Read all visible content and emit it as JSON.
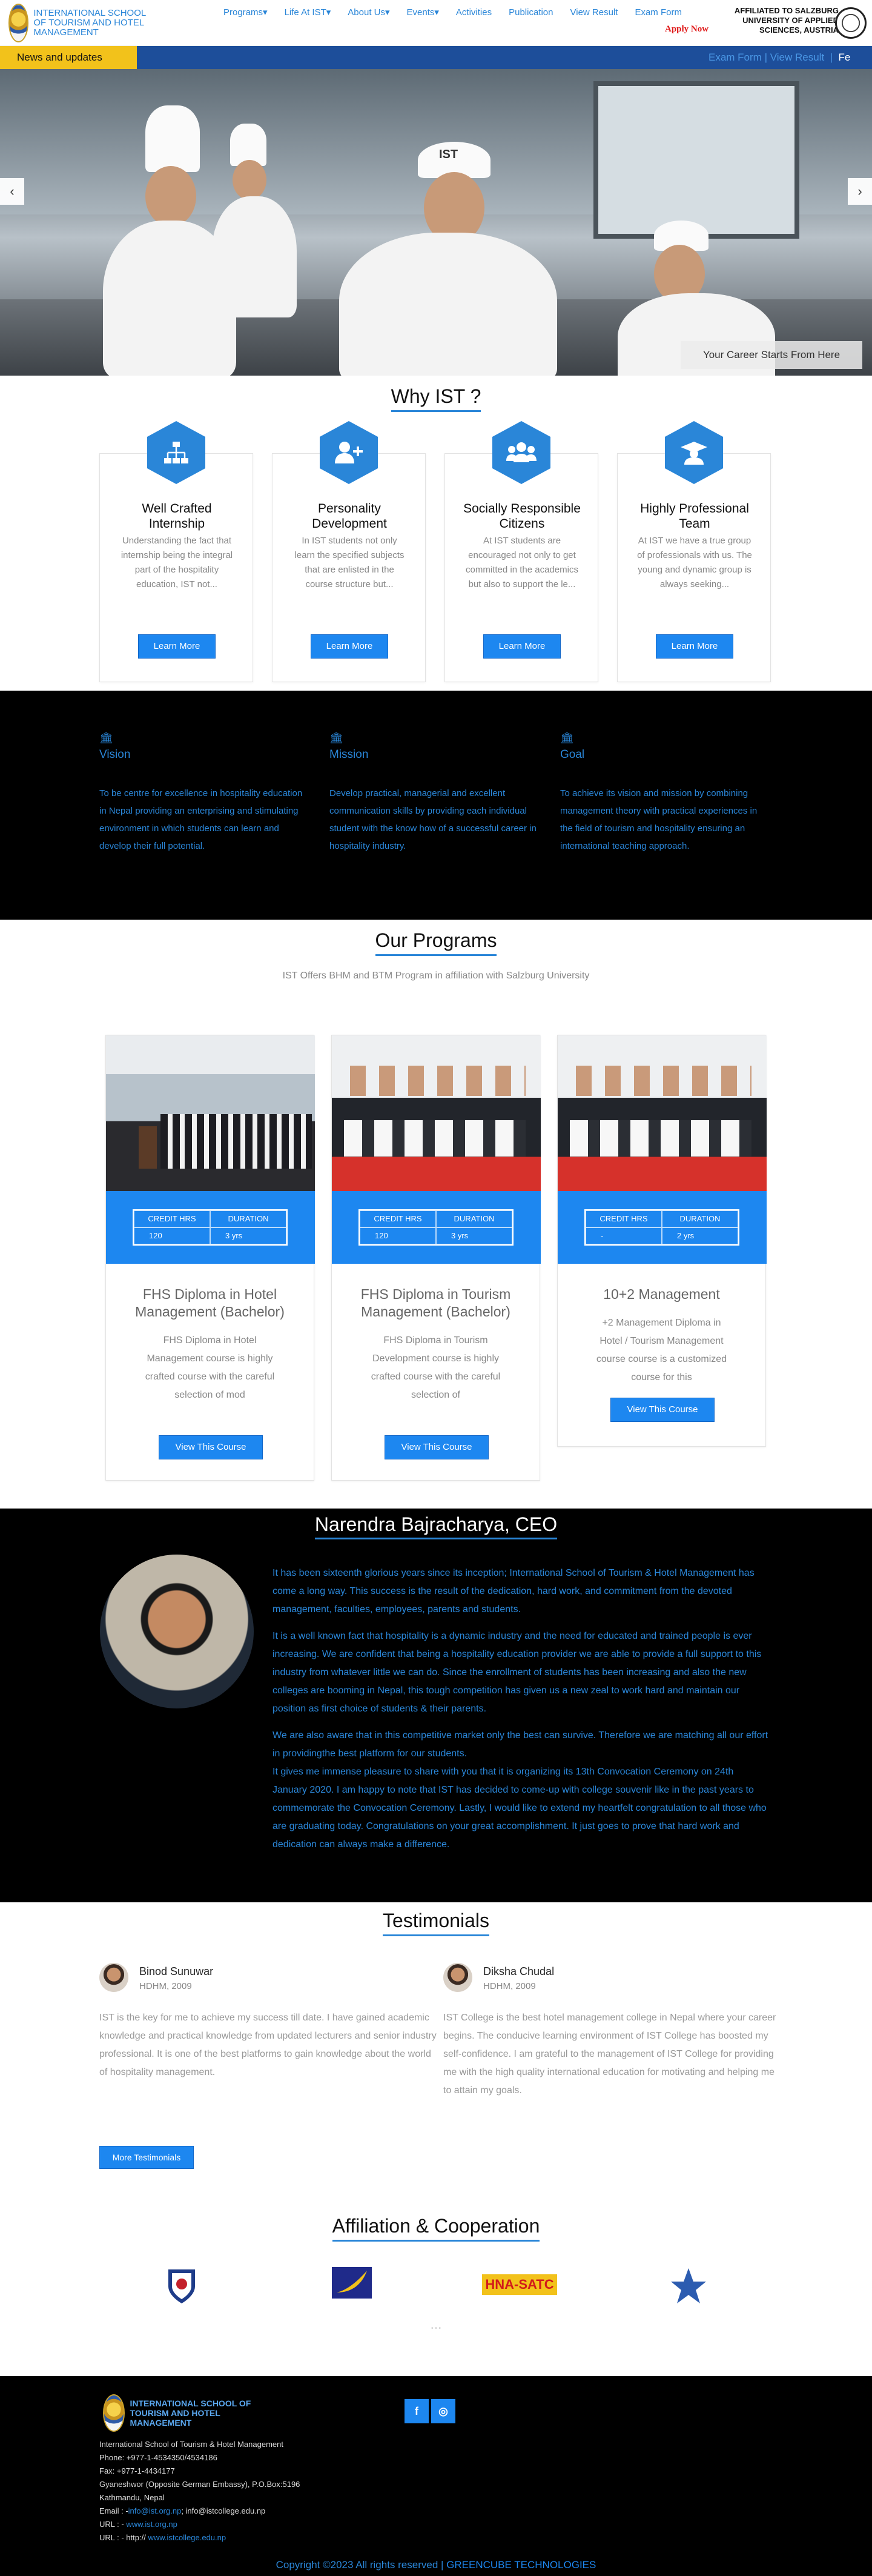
{
  "header": {
    "logo_text": "INTERNATIONAL SCHOOL OF TOURISM AND HOTEL MANAGEMENT",
    "nav": [
      {
        "label": "Programs",
        "caret": true
      },
      {
        "label": "Life At IST",
        "caret": true
      },
      {
        "label": "About Us",
        "caret": true
      },
      {
        "label": "Events",
        "caret": true
      },
      {
        "label": "Activities",
        "caret": false
      },
      {
        "label": "Publication",
        "caret": false
      },
      {
        "label": "View Result",
        "caret": false
      },
      {
        "label": "Exam Form",
        "caret": false
      }
    ],
    "apply_now": "Apply Now",
    "affiliated": "AFFILIATED TO SALZBURG UNIVERSITY OF APPLIED SCIENCES, AUSTRIA"
  },
  "ticker": {
    "label": "News and updates",
    "items": [
      "Exam Form",
      "View Result",
      "Fe"
    ]
  },
  "hero": {
    "caption": "Your Career Starts From Here",
    "cap_text": "IST"
  },
  "why": {
    "title": "Why IST ?",
    "cards": [
      {
        "title": "Well Crafted Internship",
        "icon": "sitemap-icon",
        "text": "Understanding the fact that internship being the integral part of the hospitality education, IST not...",
        "button": "Learn More"
      },
      {
        "title": "Personality Development",
        "icon": "user-plus-icon",
        "text": "In IST students not only learn the specified subjects that are enlisted in the course structure but...",
        "button": "Learn More"
      },
      {
        "title": "Socially Responsible Citizens",
        "icon": "users-icon",
        "text": "At IST students are encouraged not only to get committed in the academics but also to support the le...",
        "button": "Learn More"
      },
      {
        "title": "Highly Professional Team",
        "icon": "graduate-icon",
        "text": "At IST we have a true group of professionals with us. The young and dynamic group is always seeking...",
        "button": "Learn More"
      }
    ]
  },
  "vmg": [
    {
      "title": "Vision",
      "text": "To be centre for excellence in hospitality education in Nepal providing an enterprising and stimulating environment in which students can learn and develop their full potential."
    },
    {
      "title": "Mission",
      "text": "Develop practical, managerial and excellent communication skills by providing each individual student with the know how of a successful career in hospitality industry."
    },
    {
      "title": "Goal",
      "text": "To achieve its vision and mission by combining management theory with practical experiences in the field of tourism and hospitality ensuring an international teaching approach."
    }
  ],
  "programs": {
    "title": "Our Programs",
    "subtitle": "IST Offers BHM and BTM Program in affiliation with Salzburg University",
    "col1": "CREDIT HRS",
    "col2": "DURATION",
    "items": [
      {
        "credits": "120",
        "duration": "3 yrs",
        "title": "FHS Diploma in Hotel Management (Bachelor)",
        "text": "FHS Diploma in Hotel Management course is highly crafted course with the careful selection of mod",
        "button": "View This Course"
      },
      {
        "credits": "120",
        "duration": "3 yrs",
        "title": "FHS Diploma in Tourism Management (Bachelor)",
        "text": "FHS Diploma in Tourism Development course is highly crafted course with the careful selection of",
        "button": "View This Course"
      },
      {
        "credits": "-",
        "duration": "2 yrs",
        "title": "10+2 Management",
        "text": "+2 Management Diploma in Hotel / Tourism Management course course is a customized course for this",
        "button": "View This Course"
      }
    ]
  },
  "ceo": {
    "title": "Narendra Bajracharya, CEO",
    "paragraphs": [
      "It has been sixteenth glorious years since its inception; International School of Tourism & Hotel Management has come a long way. This success is the result of the dedication, hard work, and commitment from the devoted management, faculties, employees, parents and students.",
      "It is a well known fact that hospitality is a dynamic industry and the need for educated and trained people is ever increasing. We are confident that being a hospitality education provider we are able to provide a full support to this industry from whatever little we can do. Since the enrollment of students has been increasing and also the new colleges are booming in Nepal, this tough competition has given us a new zeal to work hard and maintain our position as first choice of students & their parents.",
      "We are also aware that in this competitive market only the best can survive. Therefore we are matching all our effort in providingthe best platform for our students.",
      "It gives me immense pleasure to share with you that it is organizing its 13th Convocation Ceremony on 24th January 2020. I am happy to note that IST has decided to come-up with college souvenir like in the past years to commemorate the Convocation Ceremony. Lastly, I would like to extend my heartfelt congratulation to all those who are graduating today. Congratulations on your great accomplishment. It just goes to prove that hard work and dedication can always make a difference."
    ]
  },
  "testimonials": {
    "title": "Testimonials",
    "items": [
      {
        "name": "Binod Sunuwar",
        "degree": "HDHM, 2009",
        "text": "IST is the key for me to achieve my success till date. I have gained academic knowledge and practical knowledge from updated lecturers and senior industry professional. It is one of the best platforms to gain knowledge about the world of hospitality management."
      },
      {
        "name": "Diksha Chudal",
        "degree": "HDHM, 2009",
        "text": "IST College is the best hotel management college in Nepal where your career begins. The conducive learning environment of IST College has boosted my self-confidence. I am grateful to the management of IST College for providing me with the high quality international education for motivating and helping me to attain my goals."
      }
    ],
    "more_button": "More Testimonials"
  },
  "affiliation": {
    "title": "Affiliation & Cooperation",
    "logos": [
      "shield-logo-icon",
      "bird-logo-icon",
      "hna-satc-logo",
      "star-logo-icon"
    ],
    "hna_text": "HNA-SATC"
  },
  "footer": {
    "logo_text": "INTERNATIONAL SCHOOL OF TOURISM AND HOTEL MANAGEMENT",
    "name": "International School of Tourism & Hotel Management",
    "phone": "Phone: +977-1-4534350/4534186",
    "fax": "Fax: +977-1-4434177",
    "address1": "Gyaneshwor (Opposite German Embassy), P.O.Box:5196",
    "address2": "Kathmandu, Nepal",
    "email_label": "Email : -",
    "email1": "info@ist.org.np",
    "email2": "info@istcollege.edu.np",
    "url1_label": "URL : -",
    "url1": "www.ist.org.np",
    "url2_label": "URL : - http://",
    "url2": "www.istcollege.edu.np",
    "social": [
      "f",
      "◎"
    ],
    "copyright": "Copyright ©2023 All rights reserved |",
    "developer": "GREENCUBE TECHNOLOGIES"
  }
}
